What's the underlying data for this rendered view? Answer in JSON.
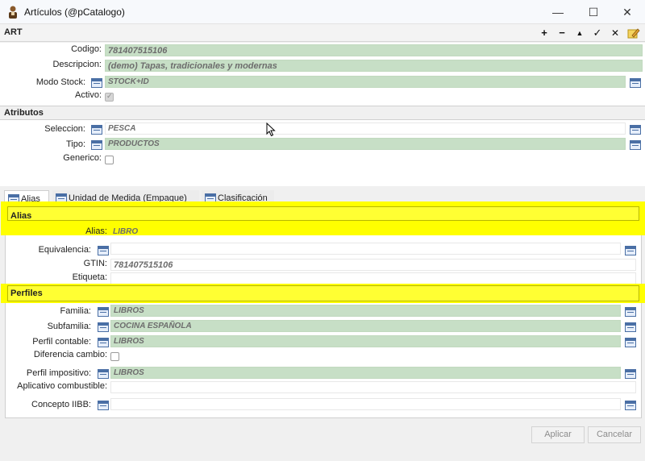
{
  "window": {
    "title": "Artículos (@pCatalogo)",
    "minimize": "—",
    "maximize": "☐",
    "close": "✕"
  },
  "toolbar": {
    "title": "ART",
    "add": "+",
    "remove": "−",
    "up": "▲",
    "accept": "✓",
    "cancel": "✕"
  },
  "main": {
    "codigo": {
      "label": "Codigo:",
      "value": "781407515106"
    },
    "descripcion": {
      "label": "Descripcion:",
      "value": "(demo) Tapas, tradicionales y modernas"
    },
    "modo_stock": {
      "label": "Modo Stock:",
      "value": "STOCK+ID"
    },
    "activo": {
      "label": "Activo:",
      "checked": true
    }
  },
  "atributos": {
    "header": "Atributos",
    "seleccion": {
      "label": "Seleccion:",
      "value": "PESCA"
    },
    "tipo": {
      "label": "Tipo:",
      "value": "PRODUCTOS"
    },
    "generico": {
      "label": "Generico:",
      "checked": false
    }
  },
  "tabs": [
    {
      "label": "Alias",
      "active": true
    },
    {
      "label": "Unidad de Medida (Empaque)",
      "active": false
    },
    {
      "label": "Clasificación",
      "active": false
    }
  ],
  "alias_section": {
    "header": "Alias",
    "alias": {
      "label": "Alias:",
      "value": "LIBRO"
    },
    "equivalencia": {
      "label": "Equivalencia:",
      "value": ""
    },
    "gtin": {
      "label": "GTIN:",
      "value": "781407515106"
    },
    "etiqueta": {
      "label": "Etiqueta:",
      "value": ""
    }
  },
  "perfiles": {
    "header": "Perfiles",
    "familia": {
      "label": "Familia:",
      "value": "LIBROS"
    },
    "subfamilia": {
      "label": "Subfamilia:",
      "value": "COCINA ESPAÑOLA"
    },
    "perfil_contable": {
      "label": "Perfil contable:",
      "value": "LIBROS"
    },
    "diferencia_cambio": {
      "label": "Diferencia cambio:",
      "checked": false
    },
    "perfil_impositivo": {
      "label": "Perfil impositivo:",
      "value": "LIBROS"
    },
    "aplicativo_combustible": {
      "label": "Aplicativo combustible:",
      "value": ""
    },
    "concepto_iibb": {
      "label": "Concepto IIBB:",
      "value": ""
    }
  },
  "buttons": {
    "aplicar": "Aplicar",
    "cancelar": "Cancelar"
  },
  "colors": {
    "readonly_field": "#c7dfc6",
    "highlight": "#ffff00",
    "icon_blue": "#4a6fa5"
  }
}
